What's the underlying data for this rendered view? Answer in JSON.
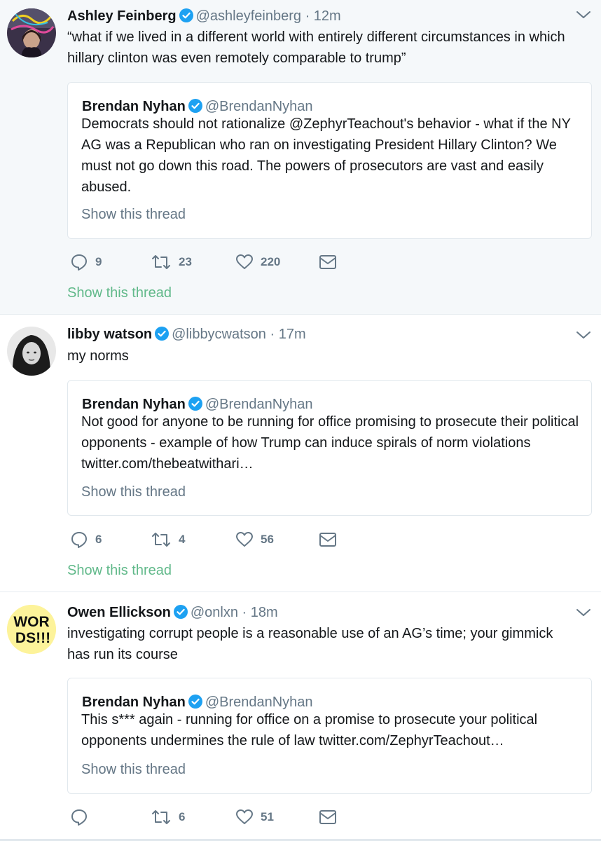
{
  "tweets": [
    {
      "name": "Ashley Feinberg",
      "handle": "@ashleyfeinberg",
      "dot": "·",
      "time": "12m",
      "text": "“what if we lived in a different world with entirely different circumstances in which hillary clinton was even remotely comparable to trump”",
      "quote": {
        "name": "Brendan Nyhan",
        "handle": "@BrendanNyhan",
        "text": "Democrats should not rationalize @ZephyrTeachout's behavior - what if the NY AG was a Republican who ran on investigating President Hillary Clinton? We must not go down this road. The powers of prosecutors are vast and easily abused.",
        "thread_label": "Show this thread"
      },
      "replies": "9",
      "retweets": "23",
      "likes": "220",
      "thread_label": "Show this thread"
    },
    {
      "name": "libby watson",
      "handle": "@libbycwatson",
      "dot": "·",
      "time": "17m",
      "text": "my norms",
      "quote": {
        "name": "Brendan Nyhan",
        "handle": "@BrendanNyhan",
        "text": "Not good for anyone to be running for office promising to prosecute their political opponents - example of how Trump can induce spirals of norm violations twitter.com/thebeatwithari…",
        "thread_label": "Show this thread"
      },
      "replies": "6",
      "retweets": "4",
      "likes": "56",
      "thread_label": "Show this thread"
    },
    {
      "name": "Owen Ellickson",
      "handle": "@onlxn",
      "dot": "·",
      "time": "18m",
      "avatar_text": "WOR DS!!!",
      "text": "investigating corrupt people is a reasonable use of an AG’s time; your gimmick has run its course",
      "quote": {
        "name": "Brendan Nyhan",
        "handle": "@BrendanNyhan",
        "text": "This s*** again - running for office on a promise to prosecute your political opponents undermines the rule of law twitter.com/ZephyrTeachout…",
        "thread_label": "Show this thread"
      },
      "replies": "",
      "retweets": "6",
      "likes": "51"
    }
  ],
  "colors": {
    "verified": "#1da1f2",
    "muted": "#657786",
    "thread_link": "#61b98a",
    "border": "#e1e8ed",
    "highlight_bg": "#f5f8fa"
  }
}
